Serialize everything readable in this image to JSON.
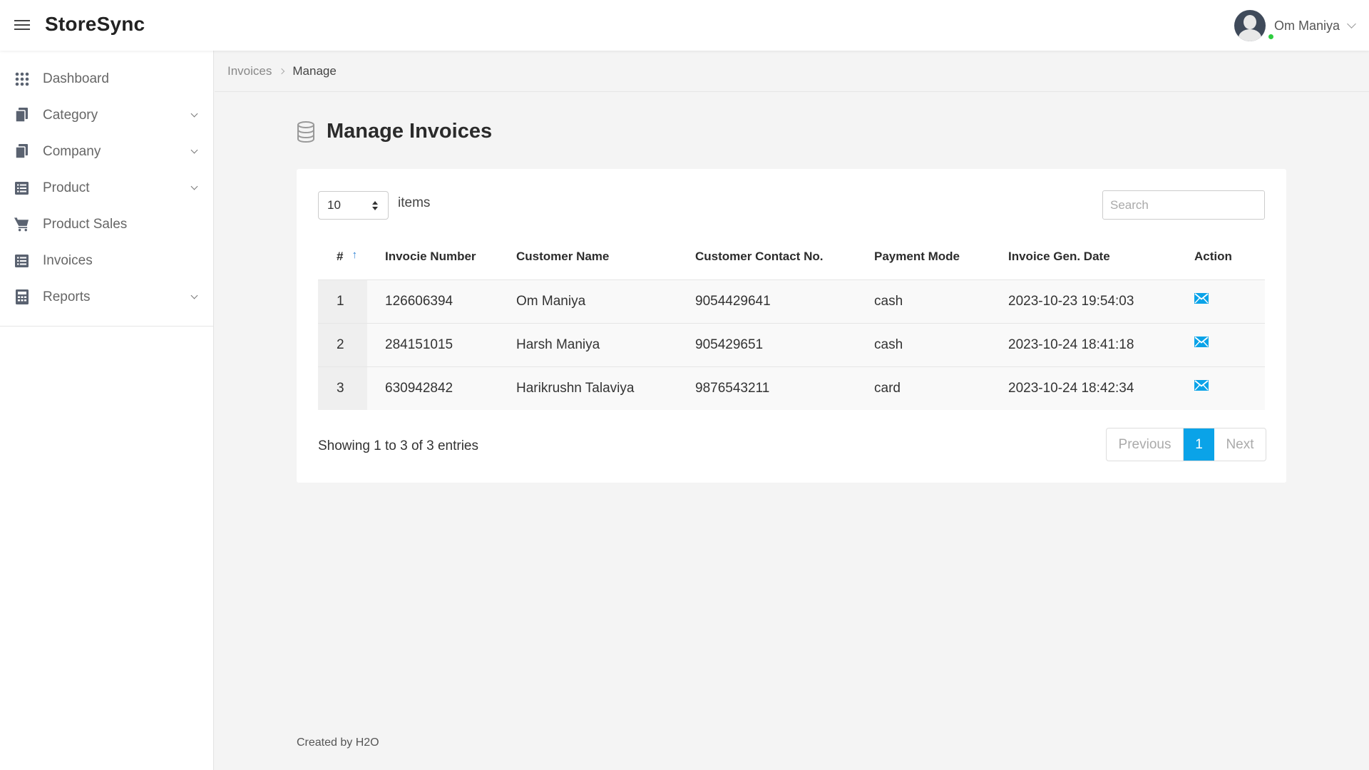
{
  "app": {
    "brand": "StoreSync"
  },
  "user": {
    "name": "Om Maniya"
  },
  "sidebar": {
    "items": [
      {
        "label": "Dashboard",
        "icon": "grid-icon",
        "has_submenu": false
      },
      {
        "label": "Category",
        "icon": "files-icon",
        "has_submenu": true
      },
      {
        "label": "Company",
        "icon": "files-icon",
        "has_submenu": true
      },
      {
        "label": "Product",
        "icon": "list-icon",
        "has_submenu": true
      },
      {
        "label": "Product Sales",
        "icon": "cart-icon",
        "has_submenu": false
      },
      {
        "label": "Invoices",
        "icon": "list-icon",
        "has_submenu": false
      },
      {
        "label": "Reports",
        "icon": "calculator-icon",
        "has_submenu": true
      }
    ]
  },
  "breadcrumb": {
    "parent": "Invoices",
    "current": "Manage"
  },
  "page": {
    "title": "Manage Invoices"
  },
  "table_controls": {
    "length_value": "10",
    "length_label": "items",
    "search_placeholder": "Search"
  },
  "table": {
    "columns": [
      "#",
      "Invocie Number",
      "Customer Name",
      "Customer Contact No.",
      "Payment Mode",
      "Invoice Gen. Date",
      "Action"
    ],
    "sort_indicator": "↑",
    "rows": [
      {
        "num": "1",
        "invoice_number": "126606394",
        "customer_name": "Om Maniya",
        "contact": "9054429641",
        "payment_mode": "cash",
        "date": "2023-10-23 19:54:03",
        "action_icon": "mail-icon"
      },
      {
        "num": "2",
        "invoice_number": "284151015",
        "customer_name": "Harsh Maniya",
        "contact": "905429651",
        "payment_mode": "cash",
        "date": "2023-10-24 18:41:18",
        "action_icon": "mail-icon"
      },
      {
        "num": "3",
        "invoice_number": "630942842",
        "customer_name": "Harikrushn Talaviya",
        "contact": "9876543211",
        "payment_mode": "card",
        "date": "2023-10-24 18:42:34",
        "action_icon": "mail-icon"
      }
    ]
  },
  "pagination": {
    "info": "Showing 1 to 3 of 3 entries",
    "previous": "Previous",
    "current": "1",
    "next": "Next"
  },
  "footer": {
    "text": "Created by H2O"
  },
  "colors": {
    "accent": "#0aa3e8",
    "online": "#2ecc40",
    "sort_arrow": "#2a7fd4"
  }
}
